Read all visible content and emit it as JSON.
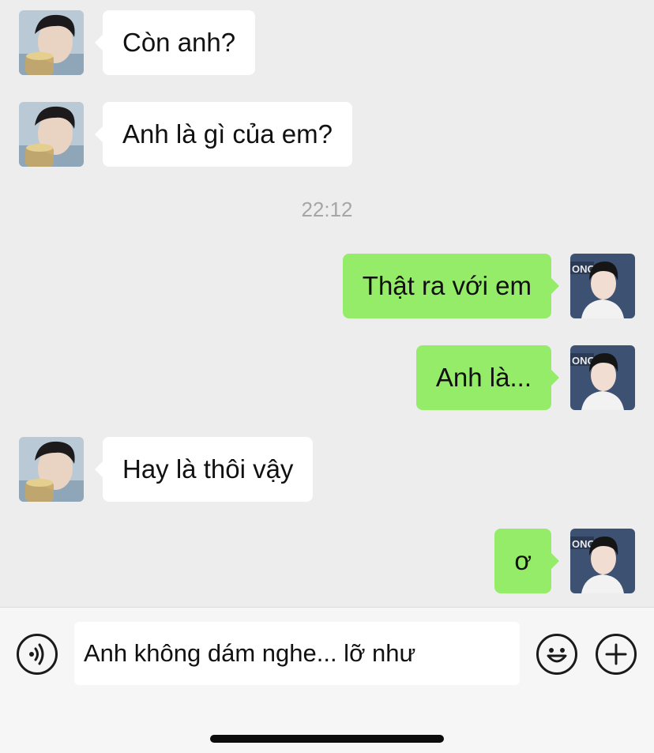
{
  "colors": {
    "background": "#ededed",
    "incoming_bubble": "#ffffff",
    "outgoing_bubble": "#95ec69",
    "timestamp_text": "#a6a6a6",
    "input_bar": "#f6f6f6"
  },
  "messages": [
    {
      "direction": "incoming",
      "text": "Còn anh?",
      "avatar": "contact-avatar"
    },
    {
      "direction": "incoming",
      "text": "Anh là gì của em?",
      "avatar": "contact-avatar"
    },
    {
      "direction": "timestamp",
      "text": "22:12"
    },
    {
      "direction": "outgoing",
      "text": "Thật ra với em",
      "avatar": "user-avatar"
    },
    {
      "direction": "outgoing",
      "text": "Anh là...",
      "avatar": "user-avatar"
    },
    {
      "direction": "incoming",
      "text": "Hay là thôi vậy",
      "avatar": "contact-avatar"
    },
    {
      "direction": "outgoing",
      "text": "ơ",
      "avatar": "user-avatar"
    }
  ],
  "input_bar": {
    "voice_icon": "voice-wave-icon",
    "text_value": "Anh không dám nghe... lỡ như",
    "emoji_icon": "smiley-icon",
    "plus_icon": "plus-icon"
  }
}
